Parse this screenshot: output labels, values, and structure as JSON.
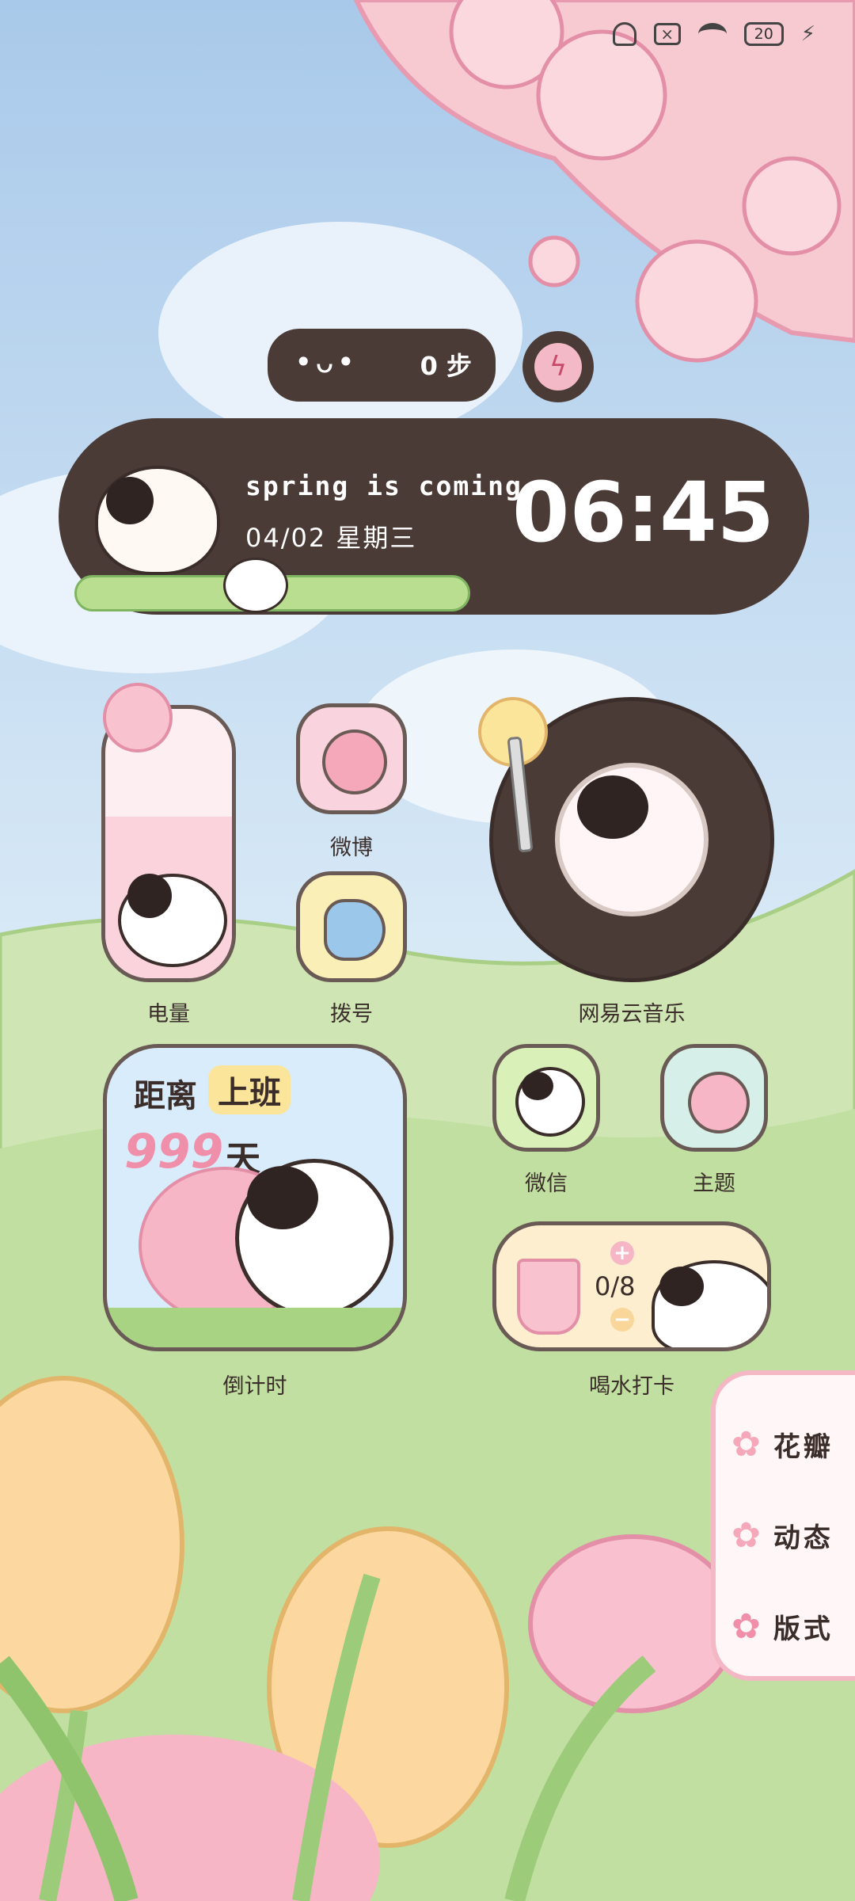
{
  "status_bar": {
    "battery": "20",
    "icons": [
      "bell-off-icon",
      "x-box-icon",
      "wifi-icon",
      "battery-icon",
      "charging-bolt-icon"
    ]
  },
  "steps_widget": {
    "face": "•ᴗ•",
    "steps": "0 步"
  },
  "clock_widget": {
    "tagline": "spring is coming",
    "date": "04/02 星期三",
    "time": "06:45"
  },
  "apps": [
    {
      "label": "电量",
      "icon": "battery-widget-icon"
    },
    {
      "label": "微博",
      "icon": "weibo-icon"
    },
    {
      "label": "拨号",
      "icon": "phone-icon"
    },
    {
      "label": "网易云音乐",
      "icon": "music-disc-icon"
    },
    {
      "label": "微信",
      "icon": "wechat-icon"
    },
    {
      "label": "主题",
      "icon": "theme-icon"
    },
    {
      "label": "倒计时",
      "icon": "countdown-icon"
    },
    {
      "label": "喝水打卡",
      "icon": "water-cup-icon"
    }
  ],
  "countdown_widget": {
    "prefix": "距离",
    "target": "上班",
    "days": "999",
    "unit": "天"
  },
  "water_widget": {
    "count": "0/8",
    "plus": "+",
    "minus": "−"
  },
  "side_panel": {
    "items": [
      {
        "label": "花瓣",
        "icon": "flower-icon"
      },
      {
        "label": "动态",
        "icon": "flower-icon"
      },
      {
        "label": "版式",
        "icon": "flower-icon"
      }
    ]
  },
  "colors": {
    "dark_brown": "#4a3b37",
    "pink": "#f7c6cf",
    "sky": "#bcd9f0",
    "grass": "#c6e3a8",
    "cream": "#fdf3e3"
  }
}
